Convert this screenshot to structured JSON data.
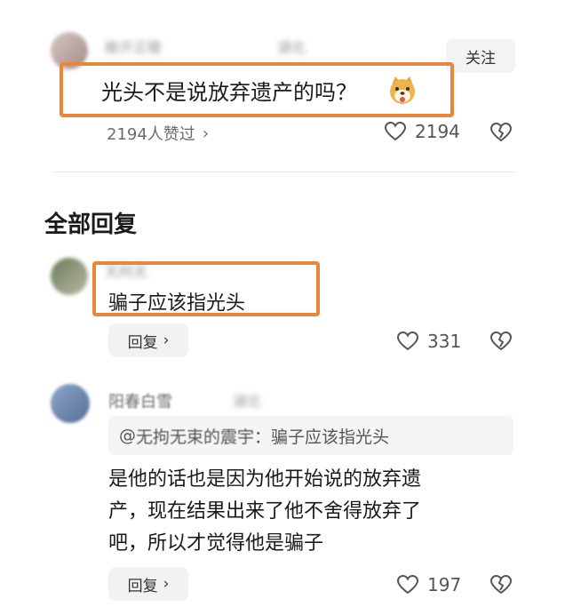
{
  "top_comment": {
    "username": "敞开正暖",
    "location": "湖北",
    "follow_label": "关注",
    "text": "光头不是说放弃遗产的吗？",
    "emoji": "dog-face-emoji",
    "likes_summary": "2194人赞过",
    "like_count": "2194"
  },
  "section_title": "全部回复",
  "replies": [
    {
      "username": "无拘无",
      "text": "骗子应该指光头",
      "reply_label": "回复",
      "like_count": "331"
    },
    {
      "username": "阳春白雪",
      "location": "湖北",
      "quote_prefix": "@",
      "quote_user": "无拘无束的震宇",
      "quote_text": "：骗子应该指光头",
      "text_lines": [
        "是他的话也是因为他开始说的放弃遗",
        "产，现在结果出来了他不舍得放弃了",
        "吧，所以才觉得他是骗子"
      ],
      "reply_label": "回复",
      "like_count": "197"
    }
  ],
  "colors": {
    "highlight": "#e9863a",
    "background": "#ffffff"
  }
}
